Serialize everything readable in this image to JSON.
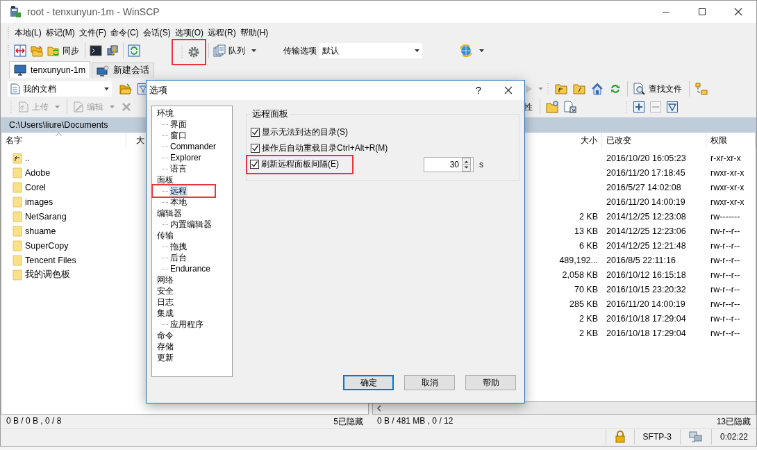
{
  "window": {
    "title": "root - tenxunyun-1m - WinSCP"
  },
  "menu": [
    "本地(L)",
    "标记(M)",
    "文件(F)",
    "命令(C)",
    "会话(S)",
    "选项(O)",
    "远程(R)",
    "帮助(H)"
  ],
  "toolbar": {
    "sync_label": "同步",
    "queue_label": "队列",
    "transfer_label": "传输选项",
    "transfer_value": "默认",
    "settings_highlighted": true
  },
  "tabs": [
    {
      "label": "tenxunyun-1m",
      "selected": true
    },
    {
      "label": "新建会话",
      "selected": false
    }
  ],
  "local_panel": {
    "location": "我的文档",
    "upload": {
      "label": "上传",
      "disabled": true
    },
    "edit": {
      "label": "编辑",
      "disabled": true
    },
    "path": "C:\\Users\\liure\\Documents",
    "columns": [
      "名字",
      "大"
    ],
    "rows": [
      {
        "name": "..",
        "kind": "parent"
      },
      {
        "name": "Adobe",
        "kind": "folder"
      },
      {
        "name": "Corel",
        "kind": "folder"
      },
      {
        "name": "images",
        "kind": "folder"
      },
      {
        "name": "NetSarang",
        "kind": "folder"
      },
      {
        "name": "shuame",
        "kind": "folder"
      },
      {
        "name": "SuperCopy",
        "kind": "folder"
      },
      {
        "name": "Tencent Files",
        "kind": "folder"
      },
      {
        "name": "我的调色板",
        "kind": "folder"
      }
    ],
    "status": "0 B / 0 B , 0 / 8",
    "hidden": "5已隐藏"
  },
  "remote_panel": {
    "find_files": "查找文件",
    "properties_partial": "性",
    "columns": [
      "大小",
      "已改变",
      "权限"
    ],
    "rows": [
      {
        "modified": "2016/10/20 16:05:23",
        "rights": "r-xr-xr-x"
      },
      {
        "modified": "2016/11/20 17:18:45",
        "rights": "rwxr-xr-x"
      },
      {
        "modified": "2016/5/27 14:02:08",
        "rights": "rwxr-xr-x"
      },
      {
        "modified": "2016/11/20 14:00:19",
        "rights": "rwxr-xr-x"
      },
      {
        "size": "2 KB",
        "modified": "2014/12/25 12:23:08",
        "rights": "rw-------"
      },
      {
        "size": "13 KB",
        "modified": "2014/12/25 12:23:06",
        "rights": "rw-r--r--"
      },
      {
        "size": "6 KB",
        "modified": "2014/12/25 12:21:48",
        "rights": "rw-r--r--"
      },
      {
        "size": "489,192...",
        "modified": "2016/8/5 22:11:16",
        "rights": "rw-r--r--"
      },
      {
        "size": "2,058 KB",
        "modified": "2016/10/12 16:15:18",
        "rights": "rw-r--r--"
      },
      {
        "size": "70 KB",
        "modified": "2016/10/15 23:20:32",
        "rights": "rw-r--r--"
      },
      {
        "size": "285 KB",
        "modified": "2016/11/20 14:00:19",
        "rights": "rw-r--r--"
      },
      {
        "size": "2 KB",
        "modified": "2016/10/18 17:29:04",
        "rights": "rw-r--r--"
      },
      {
        "size": "2 KB",
        "modified": "2016/10/18 17:29:04",
        "rights": "rw-r--r--"
      }
    ],
    "status": "0 B / 481 MB , 0 / 12",
    "hidden": "13已隐藏"
  },
  "status_bar": {
    "protocol": "SFTP-3",
    "elapsed": "0:02:22"
  },
  "dialog": {
    "title": "选项",
    "help": "?",
    "tree": [
      {
        "label": "环境",
        "selected": false,
        "children": [
          {
            "label": "界面",
            "selected": false
          },
          {
            "label": "窗口",
            "selected": false
          },
          {
            "label": "Commander",
            "selected": false
          },
          {
            "label": "Explorer",
            "selected": false
          },
          {
            "label": "语言",
            "selected": false
          }
        ]
      },
      {
        "label": "面板",
        "selected": false,
        "children": [
          {
            "label": "远程",
            "selected": true,
            "highlighted": true
          },
          {
            "label": "本地",
            "selected": false
          }
        ]
      },
      {
        "label": "编辑器",
        "selected": false,
        "children": [
          {
            "label": "内置编辑器",
            "selected": false
          }
        ]
      },
      {
        "label": "传输",
        "selected": false,
        "children": [
          {
            "label": "拖拽",
            "selected": false
          },
          {
            "label": "后台",
            "selected": false
          },
          {
            "label": "Endurance",
            "selected": false
          }
        ]
      },
      {
        "label": "网络",
        "selected": false
      },
      {
        "label": "安全",
        "selected": false
      },
      {
        "label": "日志",
        "selected": false
      },
      {
        "label": "集成",
        "selected": false,
        "children": [
          {
            "label": "应用程序",
            "selected": false
          }
        ]
      },
      {
        "label": "命令",
        "selected": false
      },
      {
        "label": "存储",
        "selected": false
      },
      {
        "label": "更新",
        "selected": false
      }
    ],
    "group": {
      "title": "远程面板",
      "options": [
        {
          "label": "显示无法到达的目录(S)",
          "checked": true,
          "highlighted": false
        },
        {
          "label": "操作后自动重载目录Ctrl+Alt+R(M)",
          "checked": true,
          "highlighted": false
        },
        {
          "label": "刷新远程面板间隔(E)",
          "checked": true,
          "highlighted": true,
          "interval": {
            "value": "30",
            "unit": "s"
          }
        }
      ]
    },
    "buttons": [
      {
        "label": "确定",
        "default": true
      },
      {
        "label": "取消",
        "default": false
      },
      {
        "label": "帮助",
        "default": false
      }
    ]
  }
}
